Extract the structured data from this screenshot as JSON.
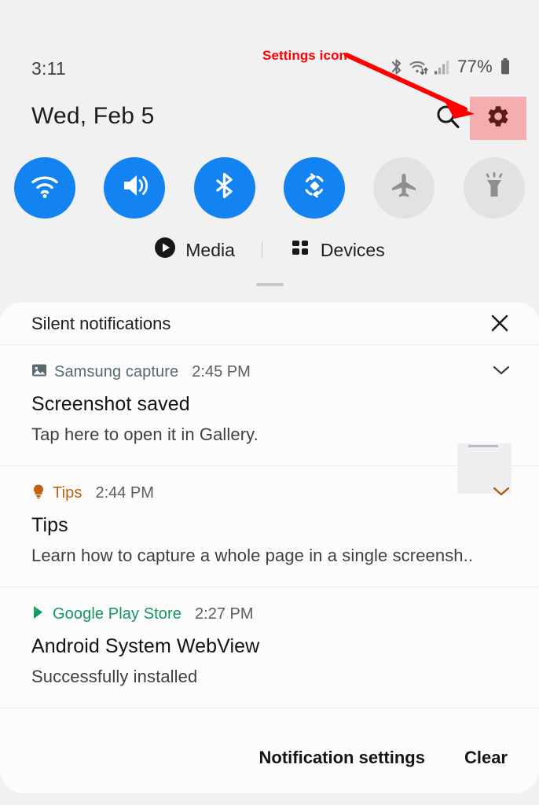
{
  "statusbar": {
    "time": "3:11",
    "battery_percent": "77%",
    "icons": [
      "bluetooth-icon",
      "wifi-icon",
      "signal-icon",
      "battery-icon"
    ]
  },
  "header": {
    "date": "Wed, Feb 5",
    "search_icon": "search-icon",
    "settings_icon": "gear-icon",
    "highlight_color": "#f4aeb0",
    "settings_icon_color": "#5d1a1a"
  },
  "annotation": {
    "label": "Settings icon",
    "color": "#fe0000",
    "arrow": "arrow-pointing-to-settings"
  },
  "quick_settings": {
    "toggles": [
      {
        "name": "wifi",
        "icon": "wifi-icon",
        "state": "on"
      },
      {
        "name": "sound",
        "icon": "volume-icon",
        "state": "on"
      },
      {
        "name": "bluetooth",
        "icon": "bluetooth-icon",
        "state": "on"
      },
      {
        "name": "auto-rotate",
        "icon": "auto-rotate-icon",
        "state": "on"
      },
      {
        "name": "airplane",
        "icon": "airplane-icon",
        "state": "off"
      },
      {
        "name": "flashlight",
        "icon": "flashlight-icon",
        "state": "off"
      }
    ],
    "on_color": "#1283f0",
    "off_color": "#e2e2e2"
  },
  "media_row": {
    "media_label": "Media",
    "media_icon": "play-circle-icon",
    "devices_label": "Devices",
    "devices_icon": "grid-squares-icon"
  },
  "notification_panel": {
    "header_title": "Silent notifications",
    "close_icon": "close-icon",
    "notifications": [
      {
        "app": "Samsung capture",
        "app_icon": "image-icon",
        "app_color": "#58696f",
        "time": "2:45 PM",
        "title": "Screenshot saved",
        "text": "Tap here to open it in Gallery.",
        "has_chevron": true,
        "has_thumbnail": true
      },
      {
        "app": "Tips",
        "app_icon": "lightbulb-icon",
        "app_color": "#c2610a",
        "time": "2:44 PM",
        "title": "Tips",
        "text": "Learn how to capture a whole page in a single screensh..",
        "has_chevron": true,
        "has_thumbnail": false
      },
      {
        "app": "Google Play Store",
        "app_icon": "play-store-icon",
        "app_color": "#11985e",
        "time": "2:27 PM",
        "title": "Android System WebView",
        "text": "Successfully installed",
        "has_chevron": false,
        "has_thumbnail": false
      }
    ],
    "actions": {
      "notification_settings_label": "Notification settings",
      "clear_label": "Clear"
    }
  }
}
